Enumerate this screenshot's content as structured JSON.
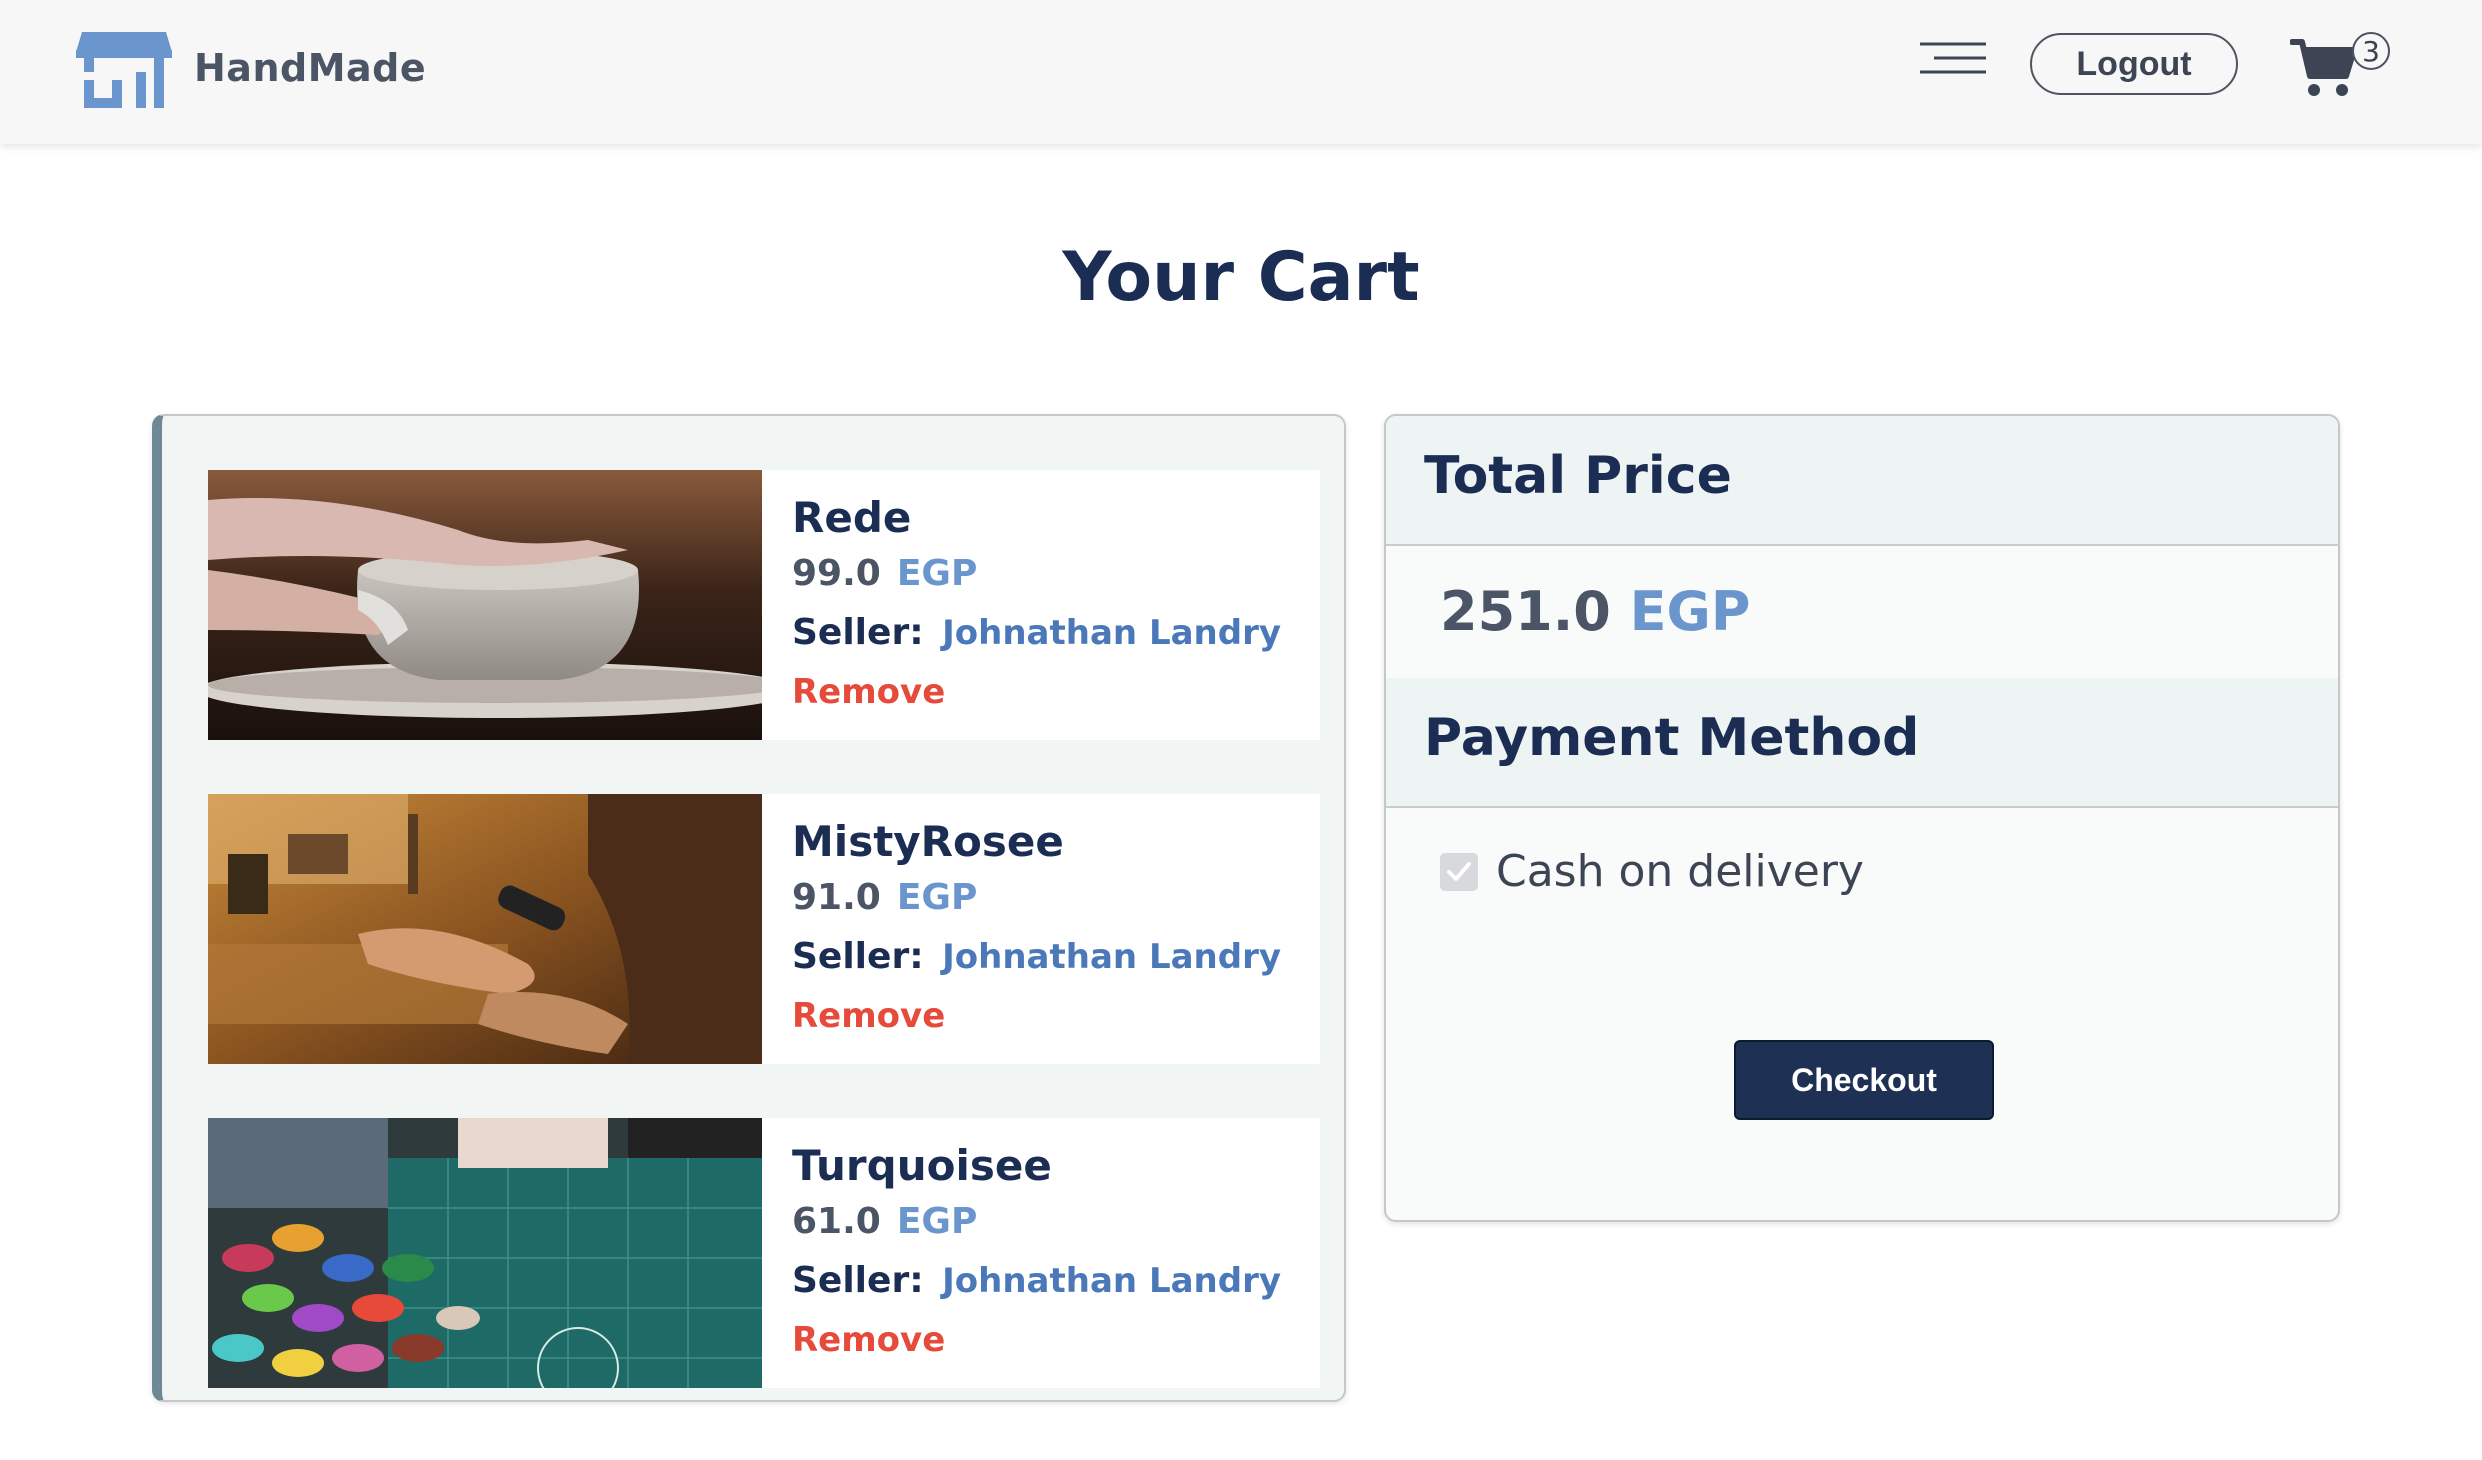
{
  "header": {
    "brand_name": "HandMade",
    "logo_icon": "shop-icon",
    "menu_icon": "hamburger-menu-icon",
    "logout_label": "Logout",
    "cart_icon": "shopping-cart-icon",
    "cart_count": "3"
  },
  "page": {
    "title": "Your Cart"
  },
  "cart": {
    "items": [
      {
        "name": "Rede",
        "price": "99.0",
        "currency": "EGP",
        "seller_label": "Seller:",
        "seller": "Johnathan Landry",
        "remove_label": "Remove",
        "image": "pottery-wheel-photo"
      },
      {
        "name": "MistyRosee",
        "price": "91.0",
        "currency": "EGP",
        "seller_label": "Seller:",
        "seller": "Johnathan Landry",
        "remove_label": "Remove",
        "image": "jewelry-workshop-photo"
      },
      {
        "name": "Turquoisee",
        "price": "61.0",
        "currency": "EGP",
        "seller_label": "Seller:",
        "seller": "Johnathan Landry",
        "remove_label": "Remove",
        "image": "embroidery-threads-photo"
      }
    ]
  },
  "summary": {
    "total_heading": "Total Price",
    "total_value": "251.0",
    "total_currency": "EGP",
    "payment_heading": "Payment Method",
    "payment_option": "Cash on delivery",
    "payment_checked": true,
    "checkout_label": "Checkout"
  },
  "colors": {
    "primary": "#1c2d54",
    "accent_blue": "#6b95cd",
    "seller_blue": "#4a78b8",
    "remove_red": "#e64a3b",
    "header_bg": "#f6f7f6"
  }
}
